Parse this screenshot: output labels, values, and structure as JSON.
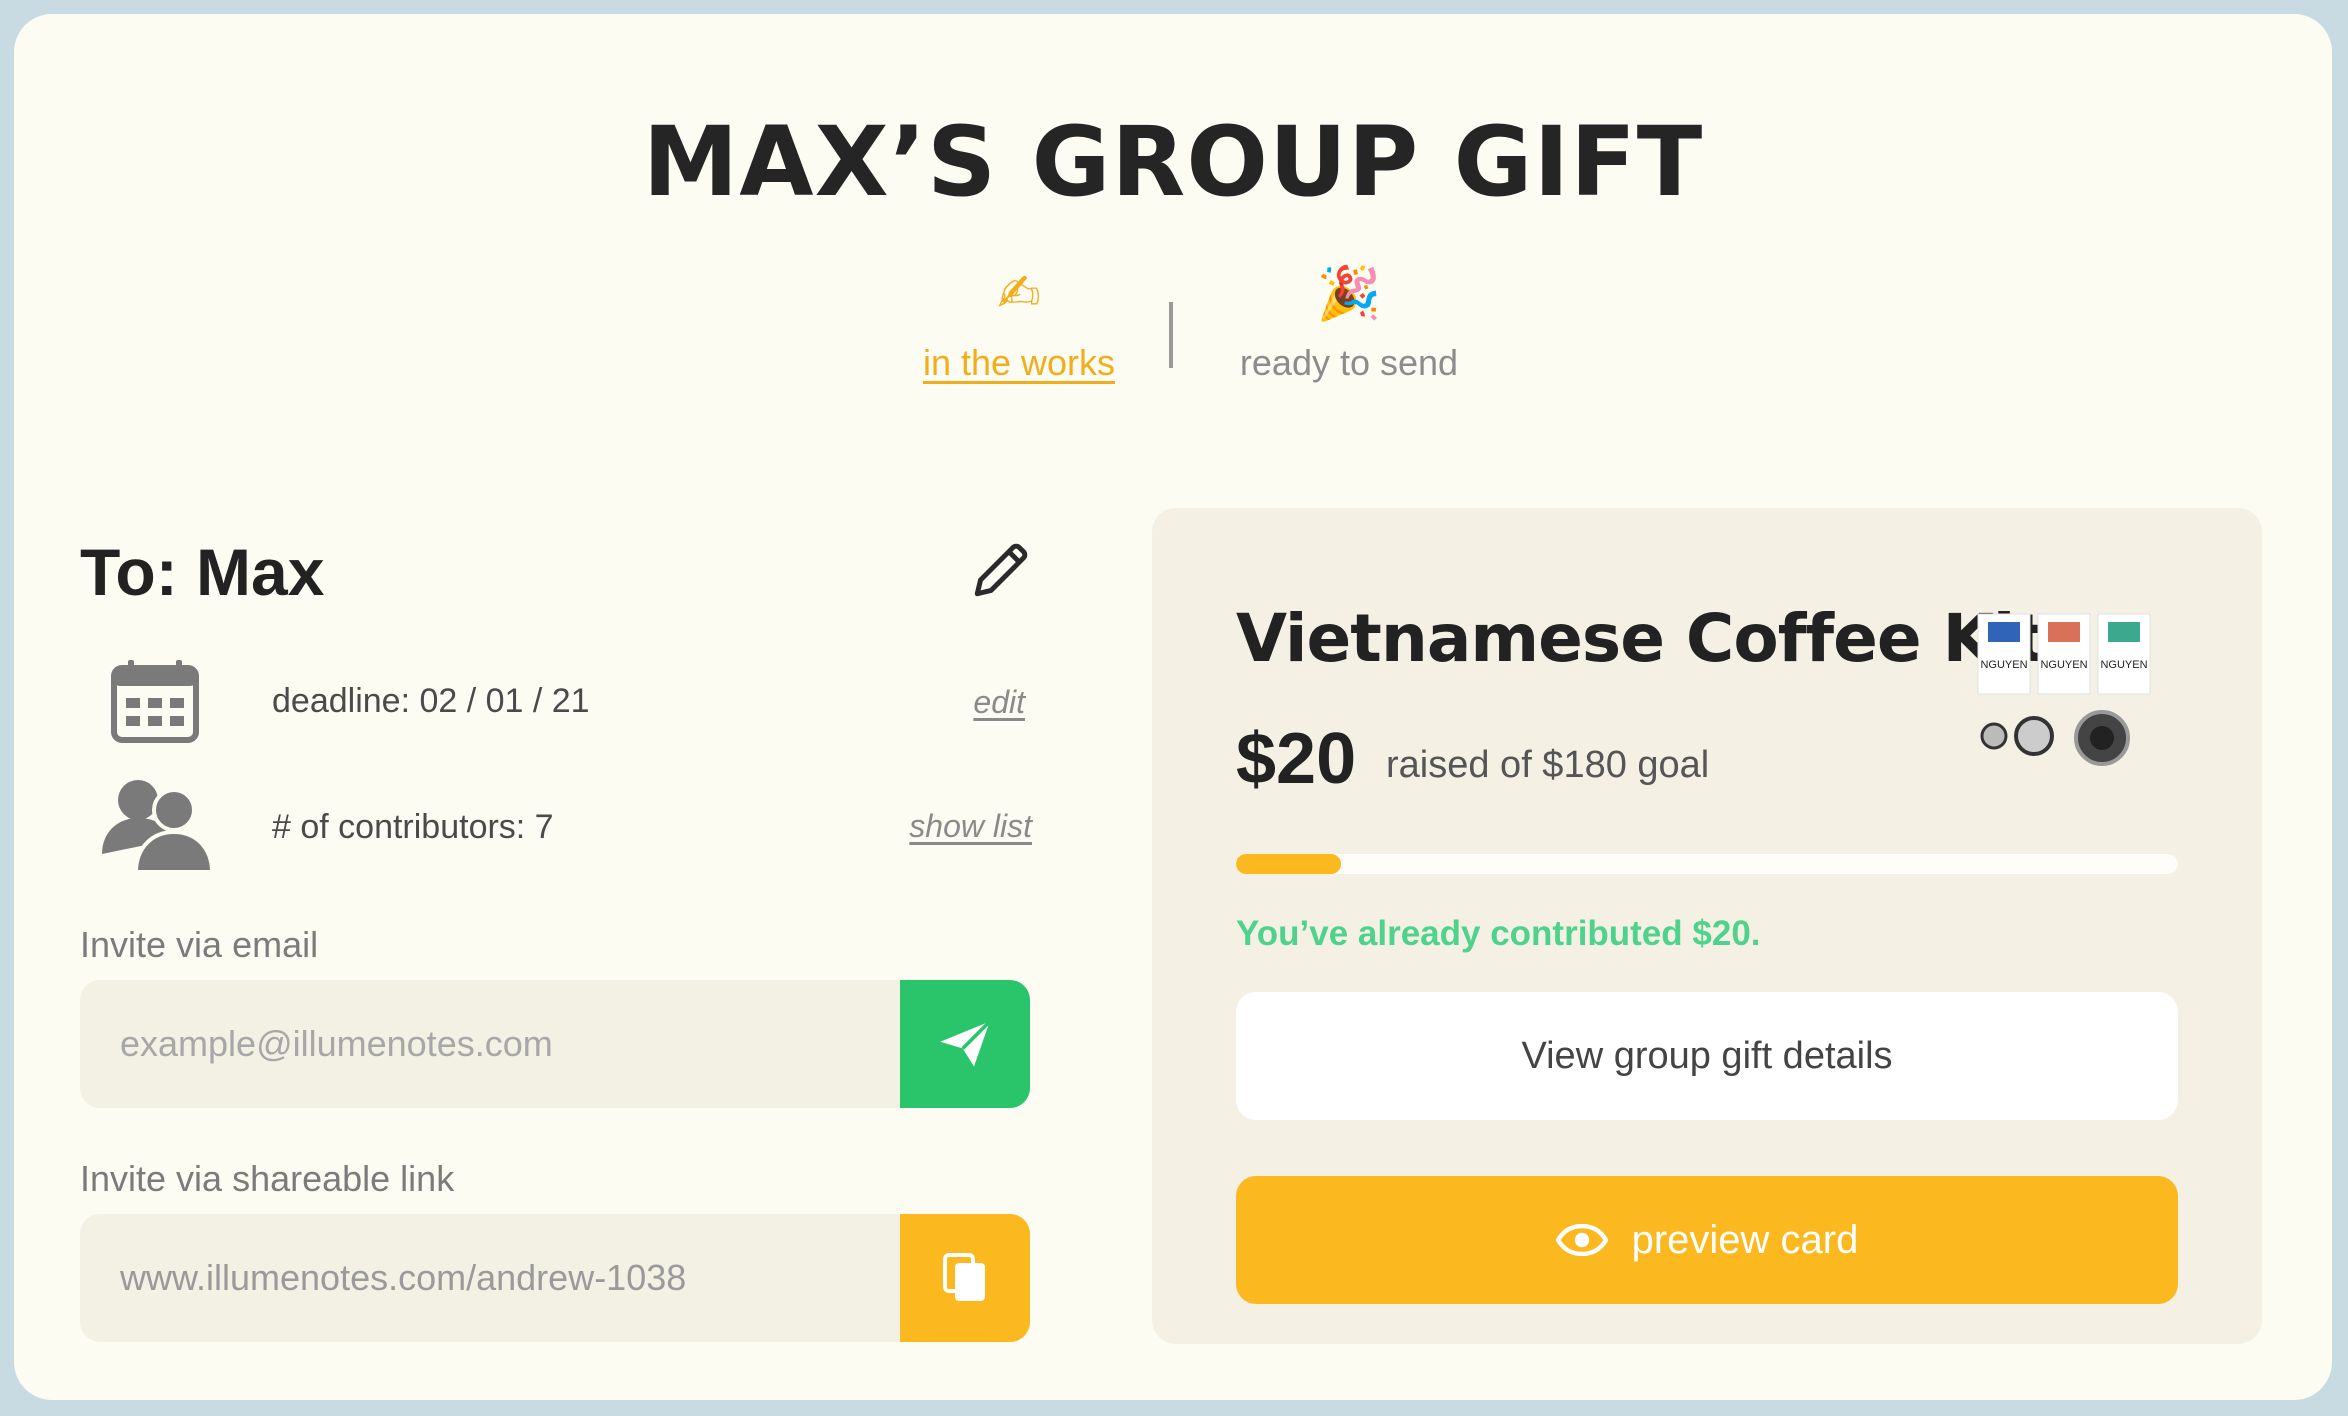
{
  "header": {
    "title": "MAX’S GROUP GIFT"
  },
  "status_tabs": [
    {
      "emoji": "✍",
      "label": "in the works",
      "active": true
    },
    {
      "emoji": "🎉",
      "label": "ready to send",
      "active": false
    }
  ],
  "recipient": {
    "to_label": "To: Max"
  },
  "deadline": {
    "text": "deadline: 02 / 01 / 21",
    "link": "edit"
  },
  "contributors": {
    "text": "# of contributors: 7",
    "link": "show list"
  },
  "invite_email": {
    "label": "Invite via email",
    "placeholder": "example@illumenotes.com"
  },
  "invite_link": {
    "label": "Invite via shareable link",
    "value": "www.illumenotes.com/andrew-1038"
  },
  "gift": {
    "name": "Vietnamese Coffee Kit",
    "raised": "$20",
    "goal_text": "raised of $180 goal",
    "progress_fraction": 0.111,
    "contributed_msg": "You’ve already contributed $20.",
    "details_button": "View group gift details",
    "preview_button": "preview card",
    "product_labels": [
      "NGUYEN",
      "NGUYEN",
      "NGUYEN"
    ]
  },
  "colors": {
    "accent_yellow": "#fbb81f",
    "accent_green": "#2ac46a",
    "success_text": "#4fd28b",
    "background": "#fdfcf3",
    "card_bg": "#f4f0e3"
  },
  "icons": [
    "pencil-icon",
    "calendar-icon",
    "people-icon",
    "send-icon",
    "copy-icon",
    "eye-icon"
  ]
}
